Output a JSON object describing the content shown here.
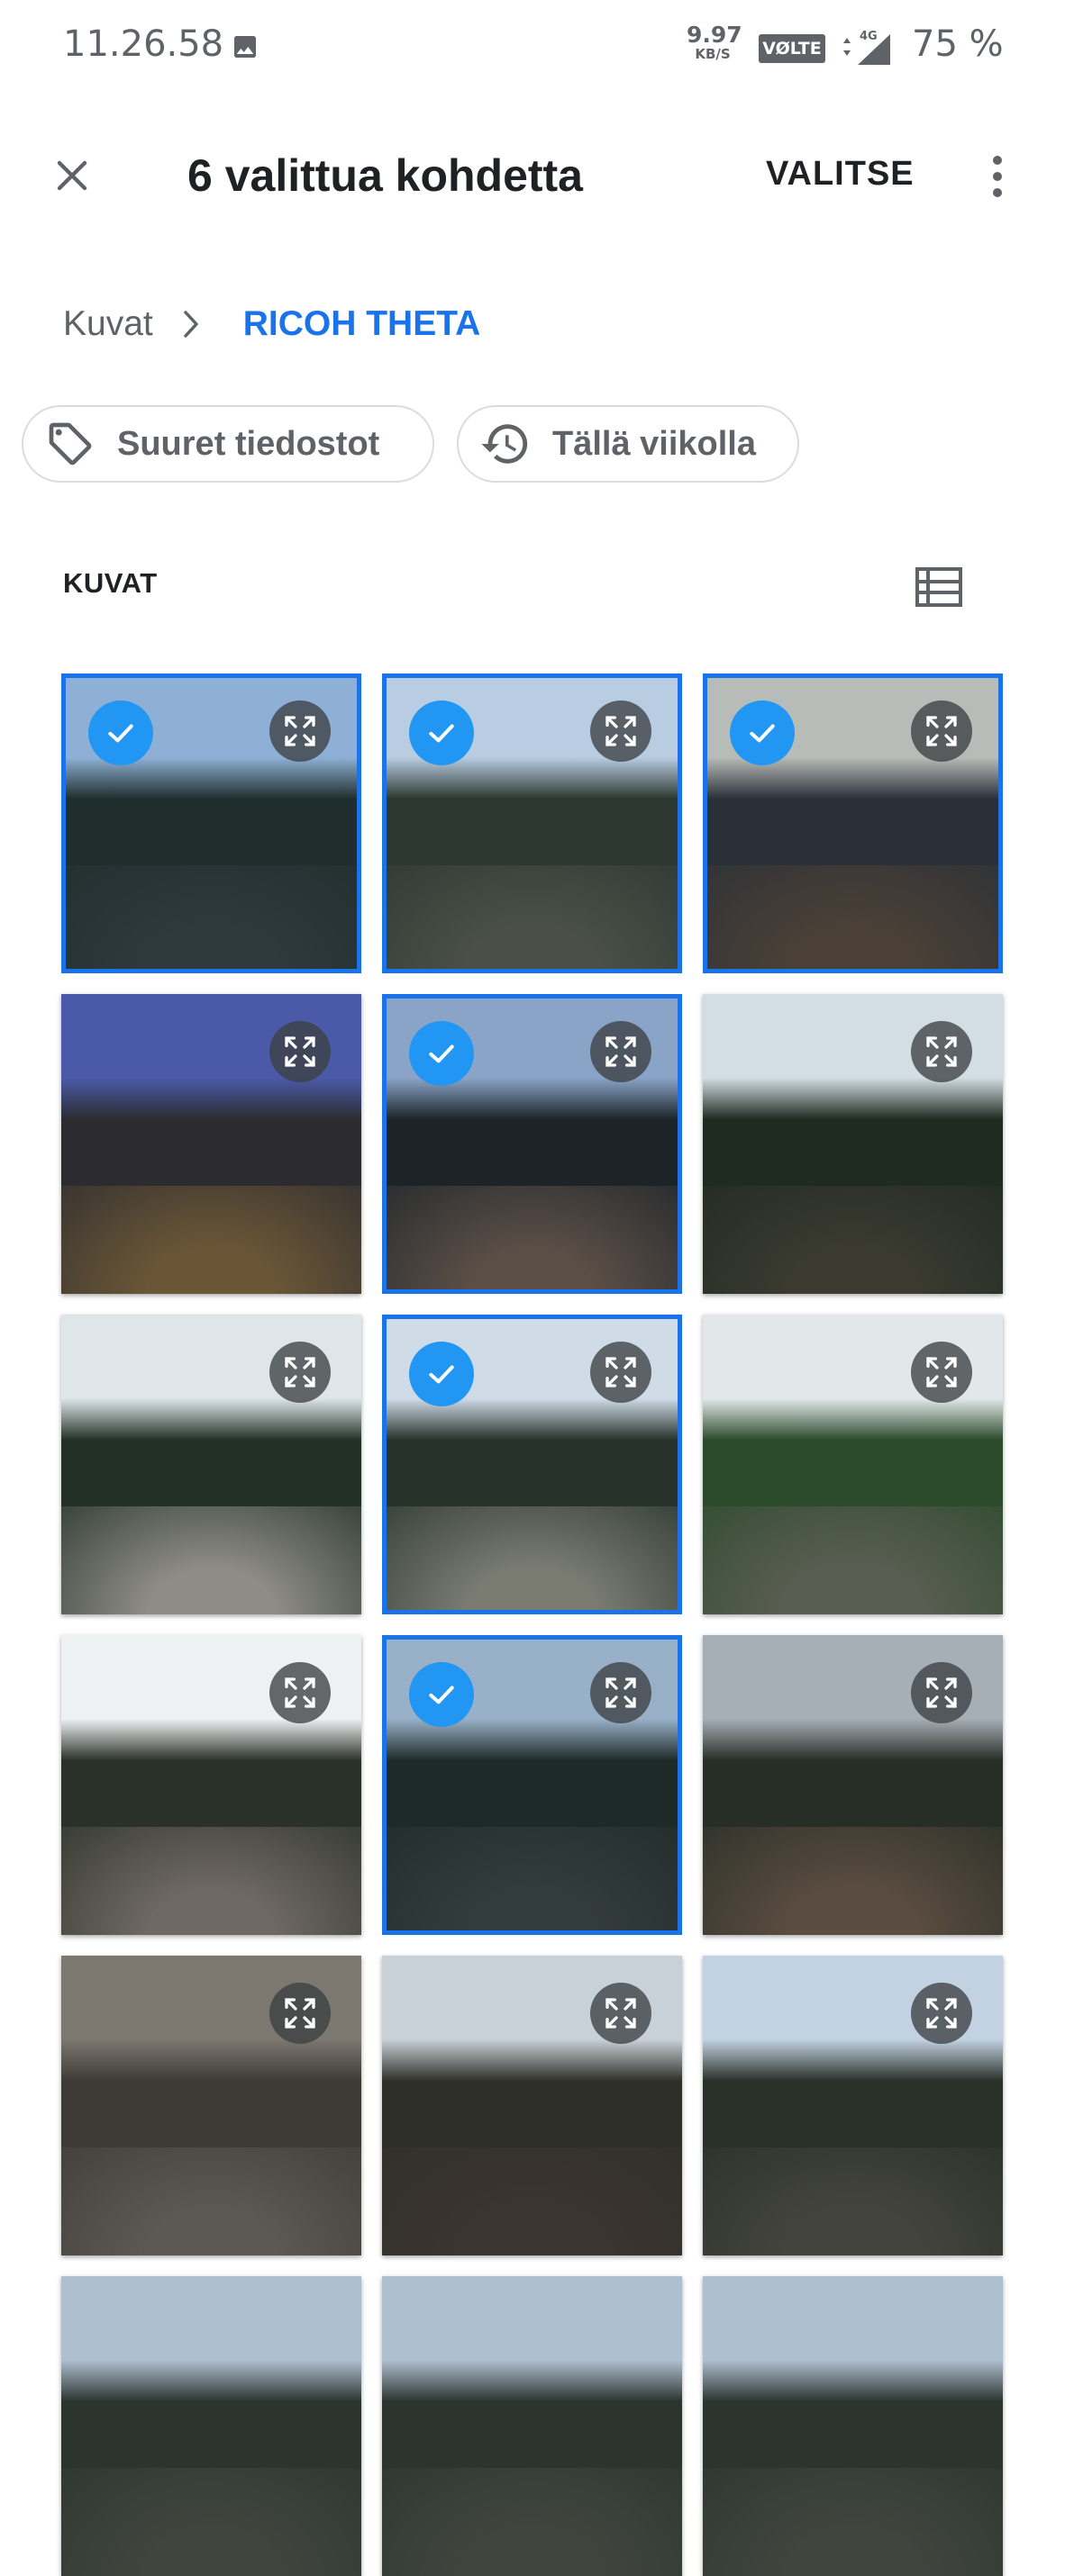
{
  "status_bar": {
    "time": "11.26.58",
    "net_speed_value": "9.97",
    "net_speed_unit": "KB/S",
    "volte": "VØLTE",
    "network": "4G",
    "battery": "75 %",
    "icons": [
      "image-icon",
      "signal-icon"
    ]
  },
  "app_bar": {
    "title": "6 valittua kohdetta",
    "select_label": "VALITSE",
    "icons": [
      "close-icon",
      "more-vert-icon"
    ]
  },
  "breadcrumb": {
    "root": "Kuvat",
    "current": "RICOH THETA",
    "current_color": "#1a73e8"
  },
  "chips": [
    {
      "label": "Suuret tiedostot",
      "icon": "tag-icon"
    },
    {
      "label": "Tällä viikolla",
      "icon": "history-icon"
    }
  ],
  "section": {
    "label": "KUVAT",
    "view_icon": "list-view-icon"
  },
  "accent_color": "#1a73e8",
  "thumbnails": [
    {
      "selected": true,
      "scene": "forest-dusk"
    },
    {
      "selected": true,
      "scene": "forest-fallen-tree"
    },
    {
      "selected": true,
      "scene": "indoor-room"
    },
    {
      "selected": false,
      "scene": "evening-houses"
    },
    {
      "selected": true,
      "scene": "field-two-people"
    },
    {
      "selected": false,
      "scene": "big-tree"
    },
    {
      "selected": false,
      "scene": "rocky-path"
    },
    {
      "selected": true,
      "scene": "person-on-path"
    },
    {
      "selected": false,
      "scene": "green-bush"
    },
    {
      "selected": false,
      "scene": "forest-road"
    },
    {
      "selected": true,
      "scene": "forest-sky"
    },
    {
      "selected": false,
      "scene": "pond-trees"
    },
    {
      "selected": false,
      "scene": "stone-arch"
    },
    {
      "selected": false,
      "scene": "field-trees"
    },
    {
      "selected": false,
      "scene": "forest-fallen-tree-2"
    },
    {
      "selected": false,
      "scene": "partial-row"
    },
    {
      "selected": false,
      "scene": "partial-row"
    },
    {
      "selected": false,
      "scene": "partial-row"
    }
  ]
}
